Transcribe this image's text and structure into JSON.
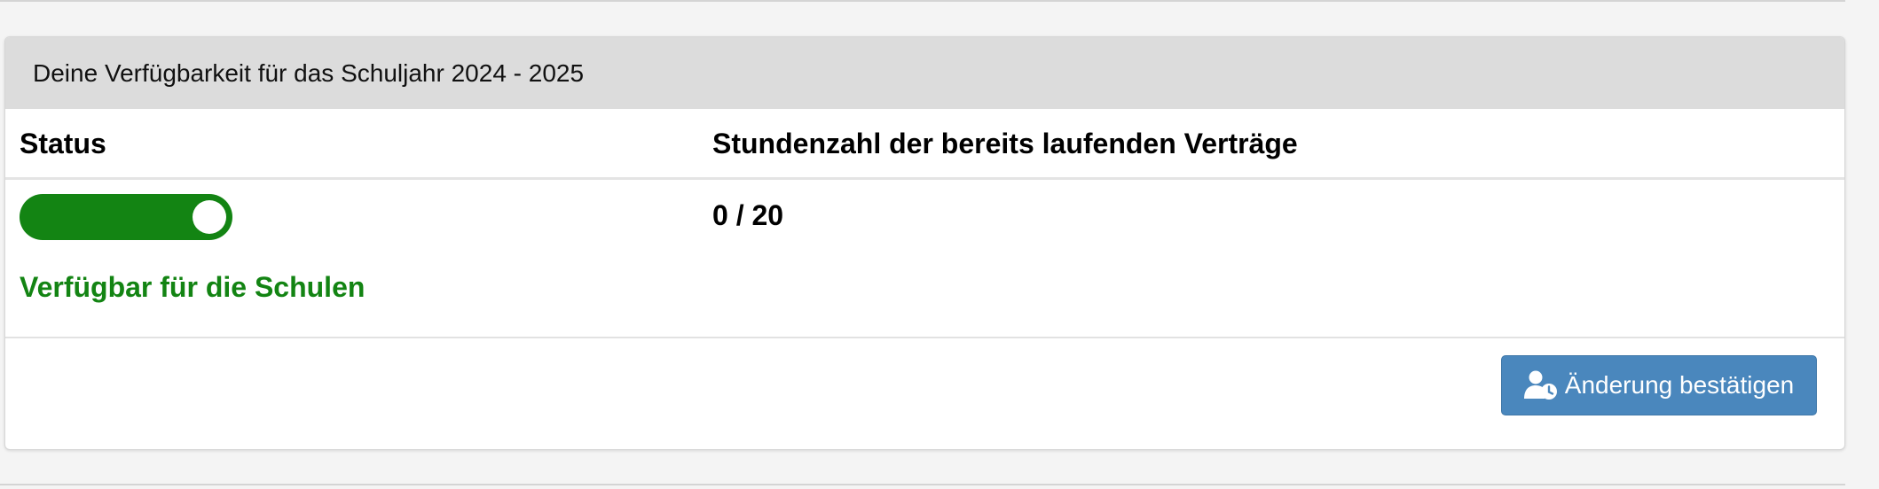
{
  "panel": {
    "title": "Deine Verfügbarkeit für das Schuljahr 2024 - 2025"
  },
  "columns": {
    "status": "Status",
    "hours": "Stundenzahl der bereits laufenden Verträge"
  },
  "status": {
    "toggle_on": true,
    "text": "Verfügbar für die Schulen"
  },
  "hours": {
    "value": "0 / 20"
  },
  "actions": {
    "confirm_label": "Änderung bestätigen",
    "confirm_icon": "user-clock-icon"
  },
  "colors": {
    "accent_green": "#138413",
    "button_blue": "#4a87bd",
    "header_gray": "#dcdcdc"
  }
}
